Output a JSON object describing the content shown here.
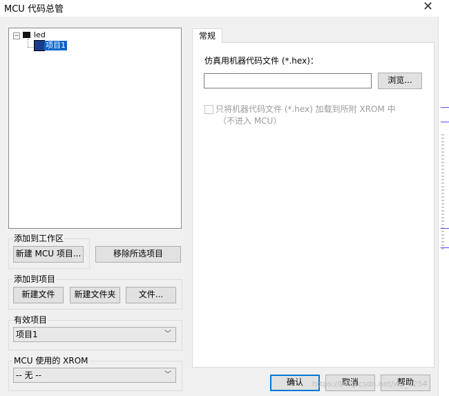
{
  "window": {
    "title": "MCU 代码总管"
  },
  "tree": {
    "root_label": "led",
    "child_label": "项目1"
  },
  "workspace_group": {
    "label": "添加到工作区",
    "new_mcu_project": "新建 MCU 项目...",
    "remove_selected": "移除所选项目"
  },
  "project_group": {
    "label": "添加到项目",
    "new_file": "新建文件",
    "new_folder": "新建文件夹",
    "file": "文件..."
  },
  "active_project": {
    "label": "有效项目",
    "selected": "项目1"
  },
  "xrom": {
    "label": "MCU 使用的 XROM",
    "selected": "-- 无 --"
  },
  "tab": {
    "label": "常规"
  },
  "general": {
    "hex_label": "仿真用机器代码文件 (*.hex)：",
    "hex_value": "",
    "browse": "浏览...",
    "checkbox_label": "只将机器代码文件 (*.hex) 加载到所附 XROM 中",
    "checkbox_sublabel": "（不进入 MCU）",
    "checkbox_checked": false,
    "checkbox_enabled": false
  },
  "footer": {
    "ok": "确认",
    "cancel": "取消",
    "help": "帮助"
  },
  "watermark": "https://blog.csdn.net/wy_0254",
  "icons": {
    "close": "close-icon",
    "tree_expander": "minus-box-icon",
    "tree_root": "chip-icon",
    "tree_child": "project-icon",
    "dropdown": "chevron-down-icon"
  },
  "colors": {
    "selection": "#0a64c8",
    "default_button_border": "#0078d7"
  }
}
